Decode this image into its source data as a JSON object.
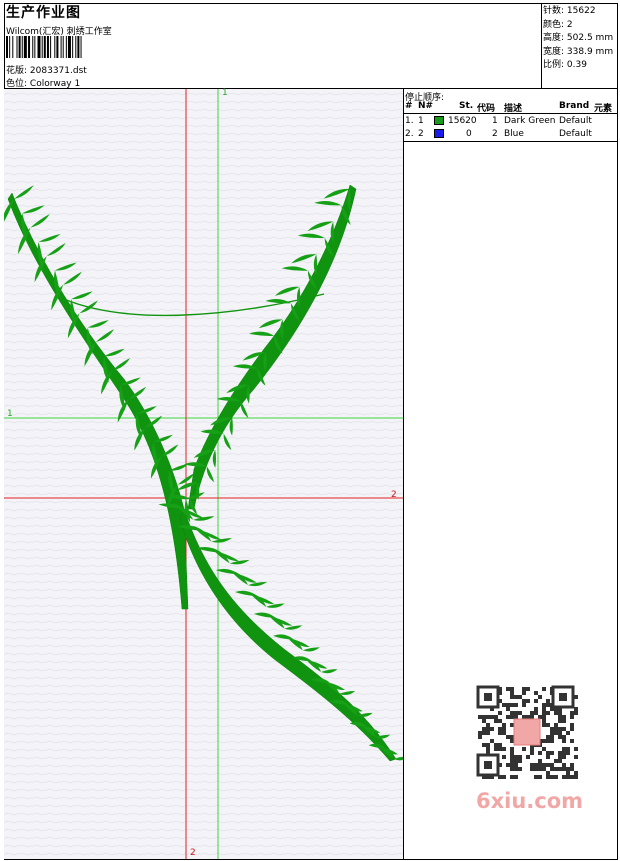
{
  "header": {
    "title": "生产作业图",
    "company": "Wilcom(汇宏) 刺绣工作室",
    "design_label": "花版:",
    "design_value": "2083371.dst",
    "colorway_label": "色位:",
    "colorway_value": "Colorway 1"
  },
  "stats": {
    "stitches_label": "针数:",
    "stitches_value": "15622",
    "colors_label": "颜色:",
    "colors_value": "2",
    "height_label": "高度:",
    "height_value": "502.5 mm",
    "width_label": "宽度:",
    "width_value": "338.9 mm",
    "scale_label": "比例:",
    "scale_value": "0.39"
  },
  "stop_sequence": {
    "title": "停止顺序:",
    "columns": [
      "#",
      "N#",
      "St.",
      "代码",
      "描述",
      "Brand",
      "元素"
    ],
    "rows": [
      {
        "index": "1.",
        "needle": "1",
        "stitches": "15620",
        "code": "1",
        "description": "Dark Green",
        "brand": "Default",
        "color": "#1a9a1a"
      },
      {
        "index": "2.",
        "needle": "2",
        "stitches": "0",
        "code": "2",
        "description": "Blue",
        "brand": "Default",
        "color": "#1a1aee"
      }
    ]
  },
  "guides": {
    "top_green": "1",
    "left_green": "1",
    "right_red": "2",
    "bottom_red": "2"
  },
  "colors": {
    "embroidery": "#109410",
    "guide_green": "#3ed43e",
    "guide_red": "#e02020"
  },
  "watermark": {
    "text": "6xiu.com"
  }
}
